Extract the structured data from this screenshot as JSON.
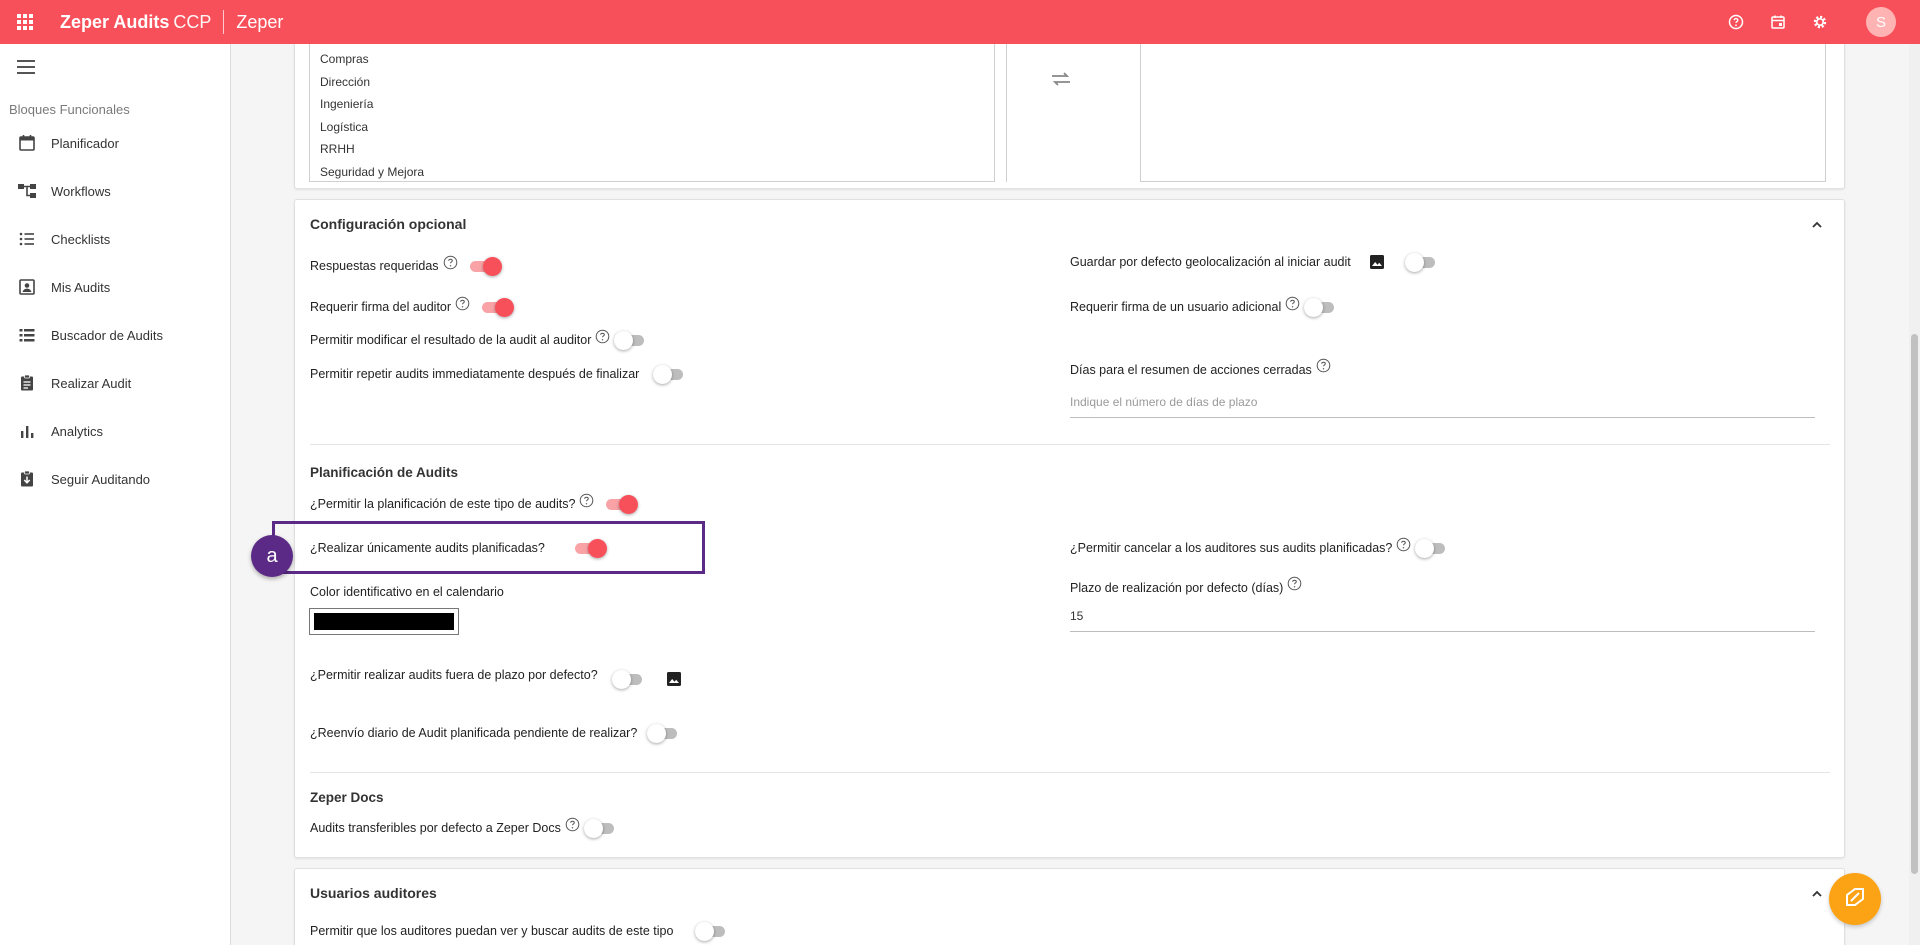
{
  "topbar": {
    "app_name": "Zeper Audits",
    "app_suffix": "CCP",
    "organization": "Zeper",
    "avatar_initial": "S",
    "icons": [
      "apps-icon",
      "help-icon",
      "calendar-icon",
      "settings-icon"
    ],
    "color": "#f8505a"
  },
  "sidebar": {
    "section_title": "Bloques Funcionales",
    "items": [
      {
        "label": "Planificador",
        "icon": "calendar-icon"
      },
      {
        "label": "Workflows",
        "icon": "workflow-icon"
      },
      {
        "label": "Checklists",
        "icon": "checklist-icon"
      },
      {
        "label": "Mis Audits",
        "icon": "contact-icon"
      },
      {
        "label": "Buscador de Audits",
        "icon": "list-icon"
      },
      {
        "label": "Realizar Audit",
        "icon": "clipboard-icon"
      },
      {
        "label": "Analytics",
        "icon": "bar-chart-icon"
      },
      {
        "label": "Seguir Auditando",
        "icon": "clipboard-download-icon"
      }
    ]
  },
  "departments": {
    "items": [
      "Compras",
      "Dirección",
      "Ingeniería",
      "Logística",
      "RRHH",
      "Seguridad y Mejora"
    ]
  },
  "config": {
    "title": "Configuración opcional",
    "respuestas": {
      "label": "Respuestas requeridas",
      "on": true
    },
    "firma_auditor": {
      "label": "Requerir firma del auditor",
      "on": true
    },
    "modificar": {
      "label": "Permitir modificar el resultado de la audit al auditor",
      "on": false
    },
    "repetir": {
      "label": "Permitir repetir audits immediatamente después de finalizar",
      "on": false
    },
    "geolocalizacion": {
      "label": "Guardar por defecto geolocalización al iniciar audit",
      "on": false
    },
    "firma_adicional": {
      "label": "Requerir firma de un usuario adicional",
      "on": false
    },
    "dias_resumen": {
      "label": "Días para el resumen de acciones cerradas",
      "placeholder": "Indique el número de días de plazo"
    }
  },
  "planificacion": {
    "title": "Planificación de Audits",
    "permitir": {
      "label": "¿Permitir la planificación de este tipo de audits?",
      "on": true
    },
    "unicamente": {
      "label": "¿Realizar únicamente audits planificadas?",
      "on": true
    },
    "cancelar": {
      "label": "¿Permitir cancelar a los auditores sus audits planificadas?",
      "on": false
    },
    "color": {
      "label": "Color identificativo en el calendario",
      "value": "#000000"
    },
    "plazo": {
      "label": "Plazo de realización por defecto (días)",
      "value": "15"
    },
    "fuera_plazo": {
      "label": "¿Permitir realizar audits fuera de plazo por defecto?",
      "on": false
    },
    "reenvio": {
      "label": "¿Reenvío diario de Audit planificada pendiente de realizar?",
      "on": false
    }
  },
  "docs": {
    "title": "Zeper Docs",
    "transferibles": {
      "label": "Audits transferibles por defecto a Zeper Docs",
      "on": false
    }
  },
  "auditores": {
    "title": "Usuarios auditores",
    "ver_buscar": {
      "label": "Permitir que los auditores puedan ver y buscar audits de este tipo",
      "on": false
    }
  },
  "annotation": {
    "badge": "a",
    "color": "#5b2a86"
  }
}
